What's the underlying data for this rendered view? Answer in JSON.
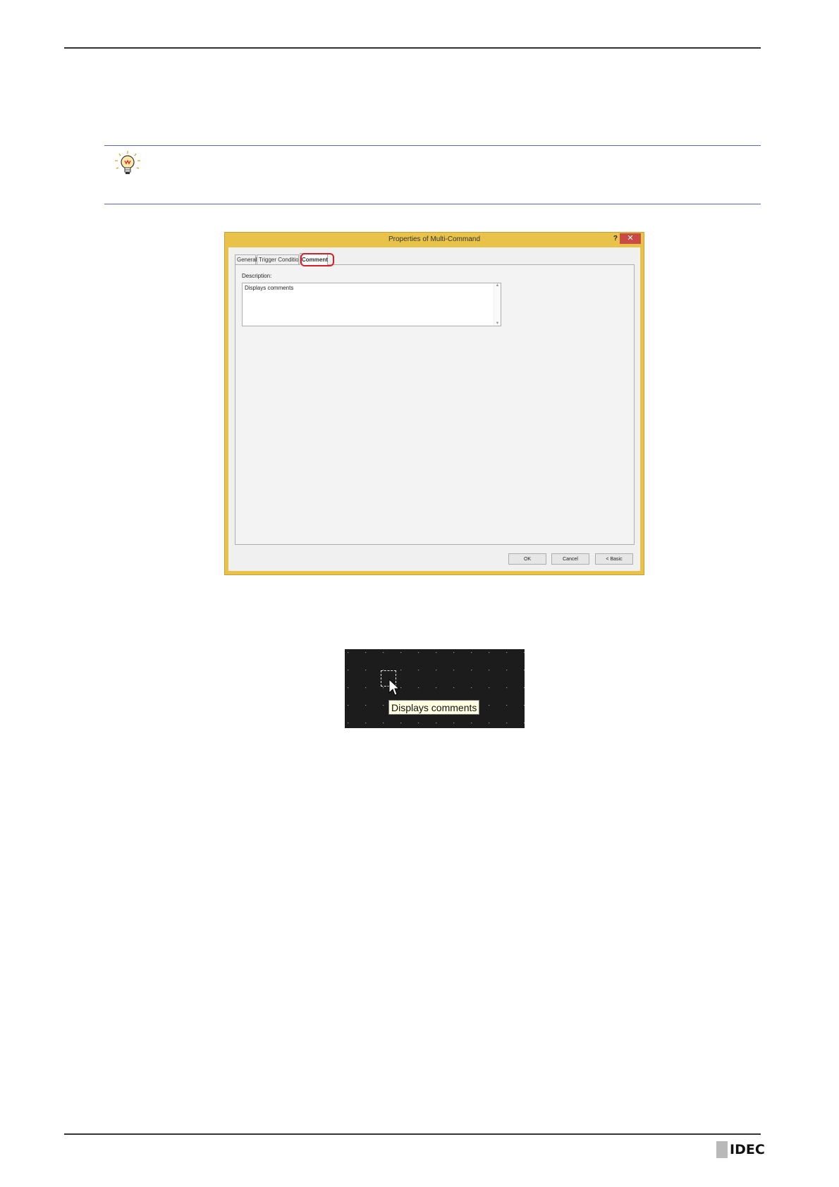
{
  "dialog": {
    "title": "Properties of Multi-Command",
    "help_label": "?",
    "close_label": "✕",
    "tabs": [
      {
        "label": "General"
      },
      {
        "label": "Trigger Condition"
      },
      {
        "label": "Comment"
      }
    ],
    "description_label": "Description:",
    "description_value": "Displays comments",
    "buttons": {
      "ok": "OK",
      "cancel": "Cancel",
      "basic": "< Basic"
    }
  },
  "screen_preview": {
    "tooltip": "Displays comments"
  },
  "logo": {
    "text": "IDEC"
  },
  "colors": {
    "dialog_frame": "#e9c24a",
    "highlight": "#d61f26",
    "screen_background": "#1c1c1c",
    "tooltip_background": "#ffffe1"
  }
}
